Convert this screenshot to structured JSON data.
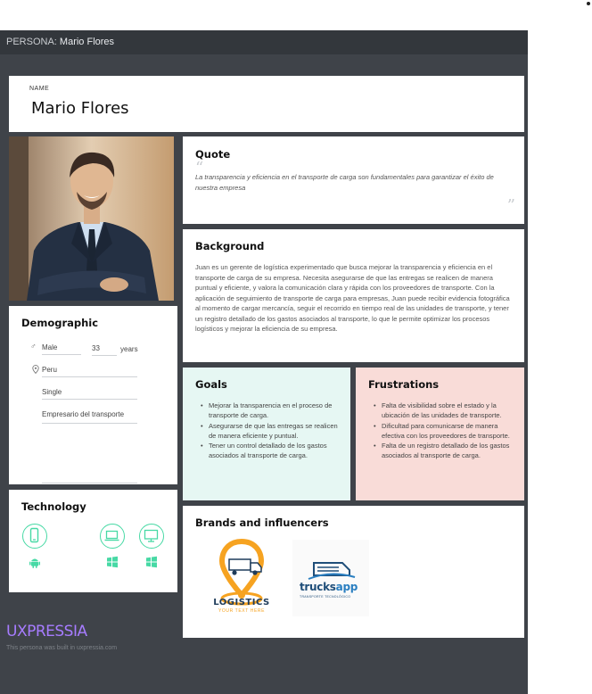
{
  "header": {
    "prefix": "PERSONA:",
    "name": "Mario Flores"
  },
  "name_card": {
    "label": "NAME",
    "value": "Mario Flores"
  },
  "quote": {
    "title": "Quote",
    "text": "La transparencia y eficiencia en el transporte de carga son fundamentales para garantizar el éxito de nuestra empresa"
  },
  "background": {
    "title": "Background",
    "text": "Juan es un gerente de logística experimentado que busca mejorar la transparencia y eficiencia en el transporte de carga de su empresa. Necesita asegurarse de que las entregas se realicen de manera puntual y eficiente, y valora la comunicación clara y rápida con los proveedores de transporte. Con la aplicación de seguimiento de transporte de carga para empresas, Juan puede recibir evidencia fotográfica al momento de cargar mercancía, seguir el recorrido en tiempo real de las unidades de transporte, y tener un registro detallado de los gastos asociados al transporte, lo que le permite optimizar los procesos logísticos y mejorar la eficiencia de su empresa."
  },
  "demographic": {
    "title": "Demographic",
    "gender": "Male",
    "age": "33",
    "age_unit": "years",
    "location": "Peru",
    "status": "Single",
    "occupation": "Empresario del transporte",
    "extra": ""
  },
  "technology": {
    "title": "Technology",
    "devices": [
      {
        "icon": "mobile-icon",
        "os": "android-icon"
      },
      {
        "icon": "laptop-icon",
        "os": "windows-icon"
      },
      {
        "icon": "desktop-icon",
        "os": "windows-icon"
      }
    ]
  },
  "goals": {
    "title": "Goals",
    "items": [
      "Mejorar la transparencia en el proceso de transporte de carga.",
      "Asegurarse de que las entregas se realicen de manera eficiente y puntual.",
      "Tener un control detallado de los gastos asociados al transporte de carga."
    ]
  },
  "frustrations": {
    "title": "Frustrations",
    "items": [
      "Falta de visibilidad sobre el estado y la ubicación de las unidades de transporte.",
      "Dificultad para comunicarse de manera efectiva con los proveedores de transporte.",
      "Falta de un registro detallado de los gastos asociados al transporte de carga."
    ]
  },
  "brands": {
    "title": "Brands and influencers",
    "logo1": {
      "word": "LOGISTICS",
      "tagline": "YOUR TEXT HERE"
    },
    "logo2": {
      "word": "trucksapp",
      "tagline": "TRANSPORTE TECNOLÓGICO"
    }
  },
  "footer": {
    "logo": "UXPRESSIA",
    "note": "This persona was built in uxpressia.com"
  },
  "colors": {
    "accent_mint": "#47d9a5",
    "goals_bg": "#e6f7f3",
    "frustrations_bg": "#f9dcd8",
    "canvas": "#3f4349",
    "footer_logo": "#a77cff"
  }
}
